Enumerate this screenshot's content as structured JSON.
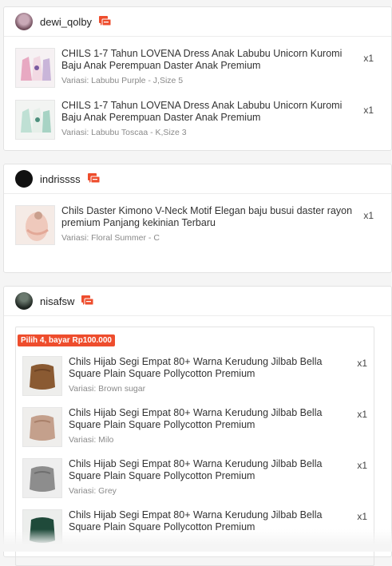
{
  "orders": [
    {
      "username": "dewi_qolby",
      "items": [
        {
          "name": "CHILS 1-7 Tahun LOVENA Dress Anak Labubu Unicorn Kuromi Baju Anak Perempuan Daster Anak Premium",
          "variant": "Variasi: Labubu Purple - J,Size 5",
          "qty": "x1"
        },
        {
          "name": "CHILS 1-7 Tahun LOVENA Dress Anak Labubu Unicorn Kuromi Baju Anak Perempuan Daster Anak Premium",
          "variant": "Variasi: Labubu Toscaa - K,Size 3",
          "qty": "x1"
        }
      ]
    },
    {
      "username": "indrissss",
      "items": [
        {
          "name": "Chils Daster Kimono V-Neck Motif Elegan baju busui daster rayon premium Panjang kekinian Terbaru",
          "variant": "Variasi: Floral Summer - C",
          "qty": "x1"
        }
      ]
    },
    {
      "username": "nisafsw",
      "promo_label": "Pilih 4, bayar Rp100.000",
      "items": [
        {
          "name": "Chils Hijab Segi Empat 80+ Warna Kerudung Jilbab Bella Square Plain Square Pollycotton Premium",
          "variant": "Variasi: Brown sugar",
          "qty": "x1"
        },
        {
          "name": "Chils Hijab Segi Empat 80+ Warna Kerudung Jilbab Bella Square Plain Square Pollycotton Premium",
          "variant": "Variasi: Milo",
          "qty": "x1"
        },
        {
          "name": "Chils Hijab Segi Empat 80+ Warna Kerudung Jilbab Bella Square Plain Square Pollycotton Premium",
          "variant": "Variasi: Grey",
          "qty": "x1"
        },
        {
          "name": "Chils Hijab Segi Empat 80+ Warna Kerudung Jilbab Bella Square Plain Square Pollycotton Premium",
          "variant": "",
          "qty": "x1"
        }
      ]
    }
  ],
  "colors": {
    "accent": "#ee4d2d"
  },
  "icons": {
    "chat": "chat-icon"
  }
}
